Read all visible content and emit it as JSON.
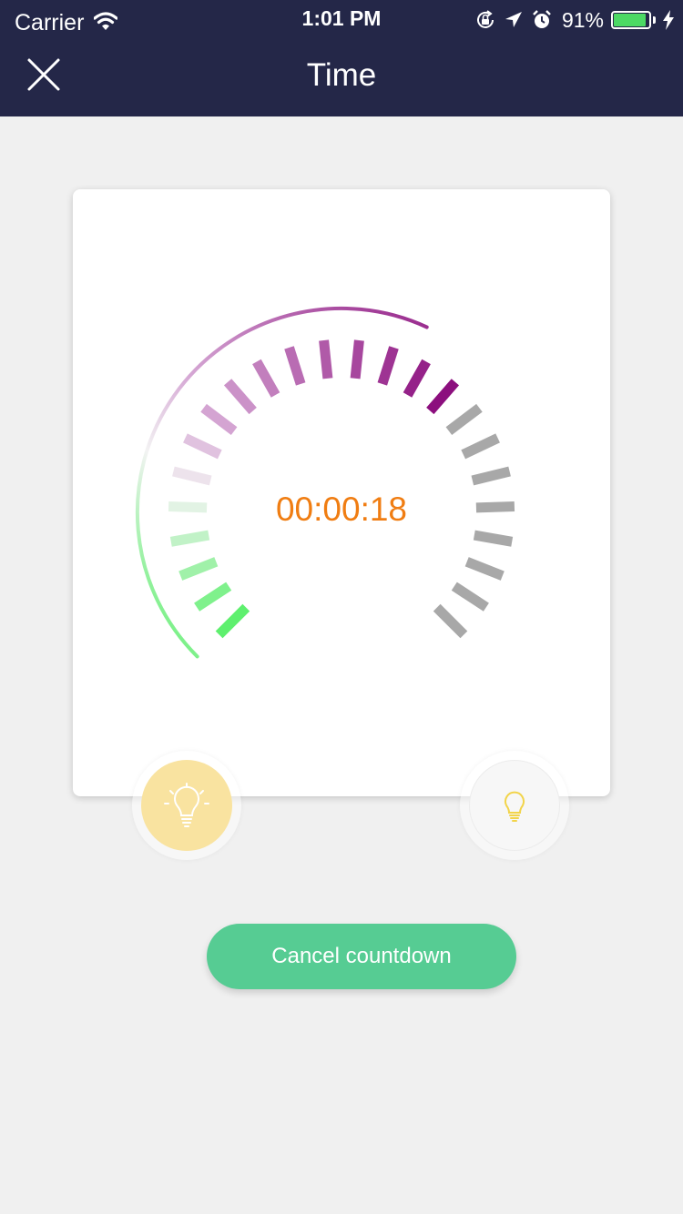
{
  "status_bar": {
    "carrier": "Carrier",
    "time": "1:01 PM",
    "battery_percent": "91%",
    "battery_level": 0.91,
    "icons": [
      "wifi-icon",
      "orientation-lock-icon",
      "location-icon",
      "alarm-icon",
      "battery-icon",
      "charging-icon"
    ]
  },
  "nav": {
    "title": "Time",
    "close_icon": "close-icon"
  },
  "timer": {
    "remaining": "00:00:18",
    "progress": 0.68
  },
  "lights": {
    "on_icon": "lightbulb-on-icon",
    "off_icon": "lightbulb-off-icon"
  },
  "actions": {
    "cancel_label": "Cancel countdown"
  },
  "colors": {
    "nav_background": "#242748",
    "timer_text": "#f07d12",
    "button": "#56cc93",
    "gauge_start": "#5ef06e",
    "gauge_end": "#8c0f7e",
    "gauge_inactive": "#a8a8a8",
    "bulb_on_fill": "#f9e3a0"
  }
}
